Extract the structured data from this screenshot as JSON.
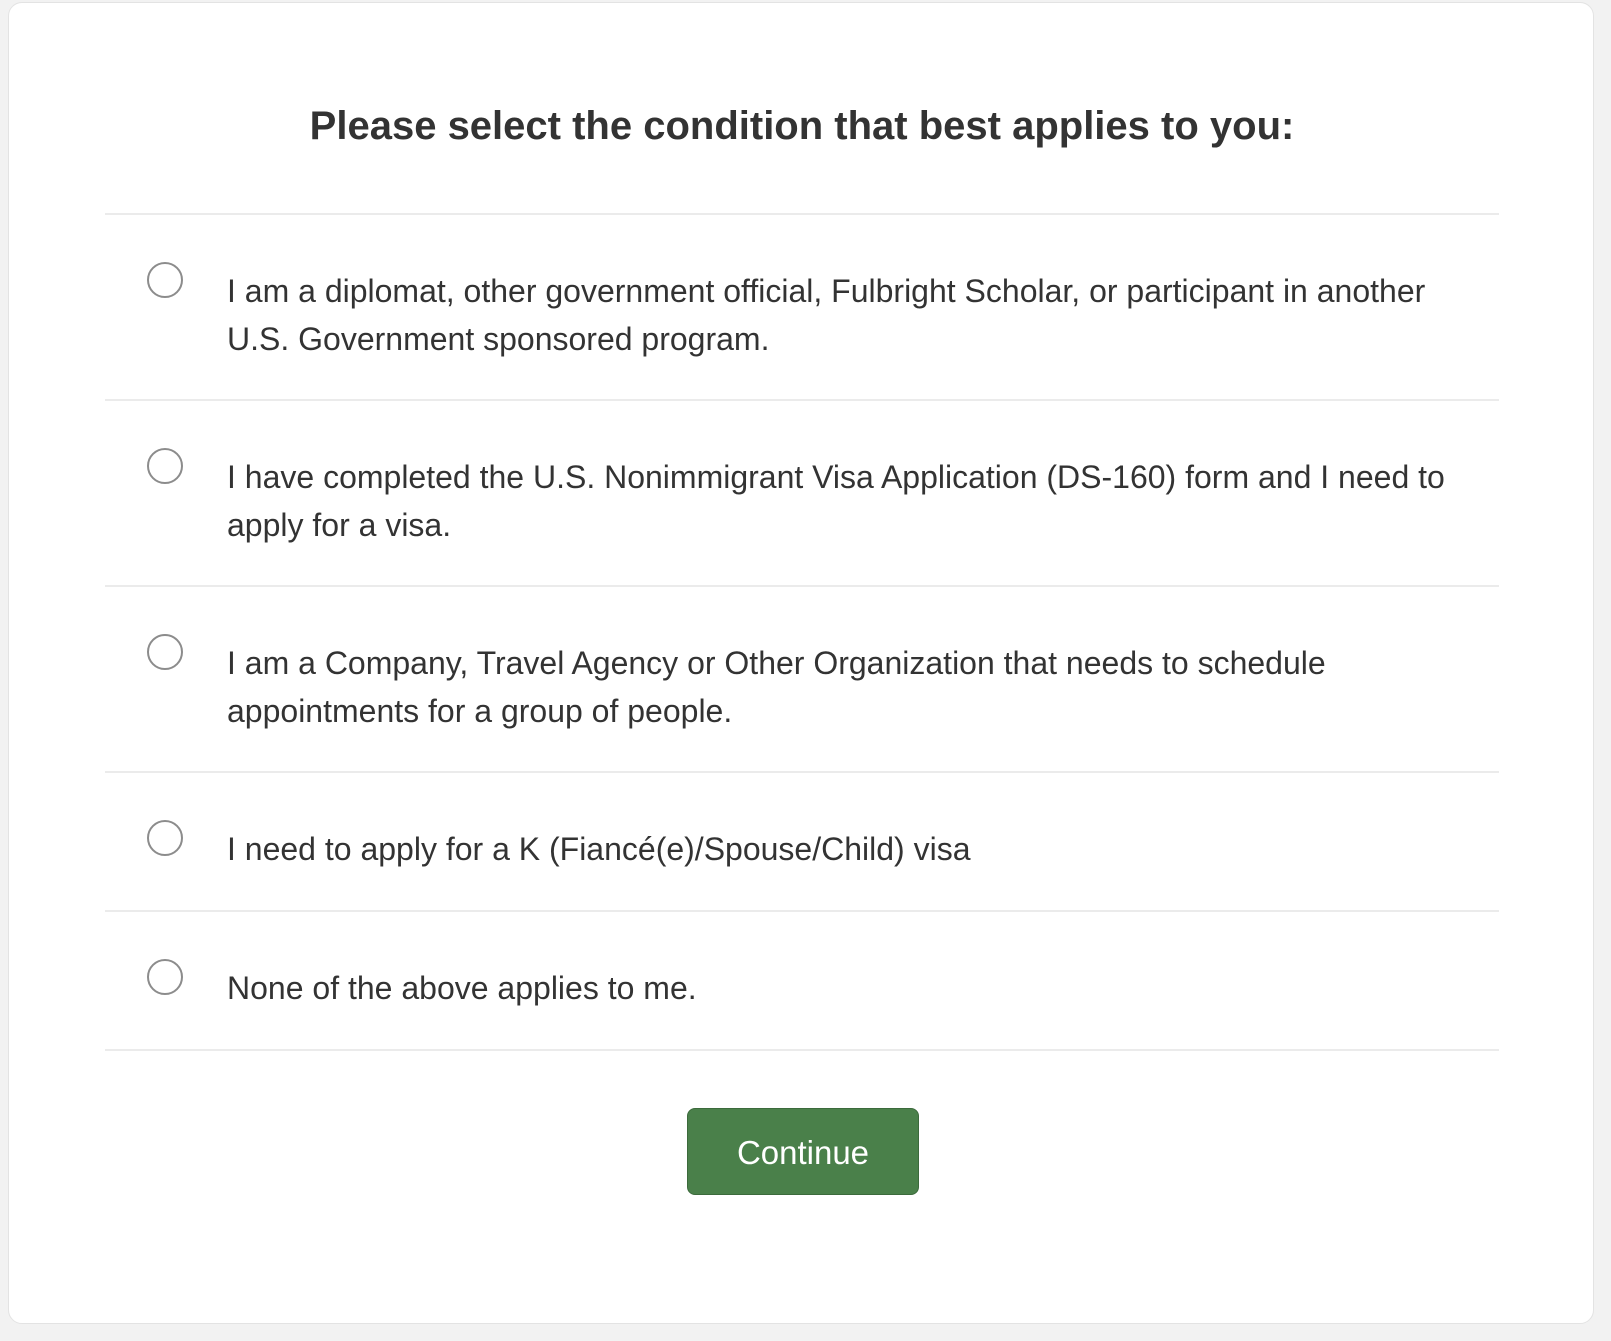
{
  "page": {
    "title": "Please select the condition that best applies to you:"
  },
  "options": [
    {
      "label": "I am a diplomat, other government official, Fulbright Scholar, or participant in another U.S. Government sponsored program.",
      "selected": false
    },
    {
      "label": "I have completed the U.S. Nonimmigrant Visa Application (DS-160) form and I need to apply for a visa.",
      "selected": false
    },
    {
      "label": "I am a Company, Travel Agency or Other Organization that needs to schedule appointments for a group of people.",
      "selected": false
    },
    {
      "label": "I need to apply for a K (Fiancé(e)/Spouse/Child) visa",
      "selected": false
    },
    {
      "label": "None of the above applies to me.",
      "selected": false
    }
  ],
  "actions": {
    "continue_label": "Continue"
  },
  "colors": {
    "primary_button": "#4a804a",
    "text": "#333333",
    "divider": "#ebebeb",
    "radio_border": "#8c8c8c"
  }
}
